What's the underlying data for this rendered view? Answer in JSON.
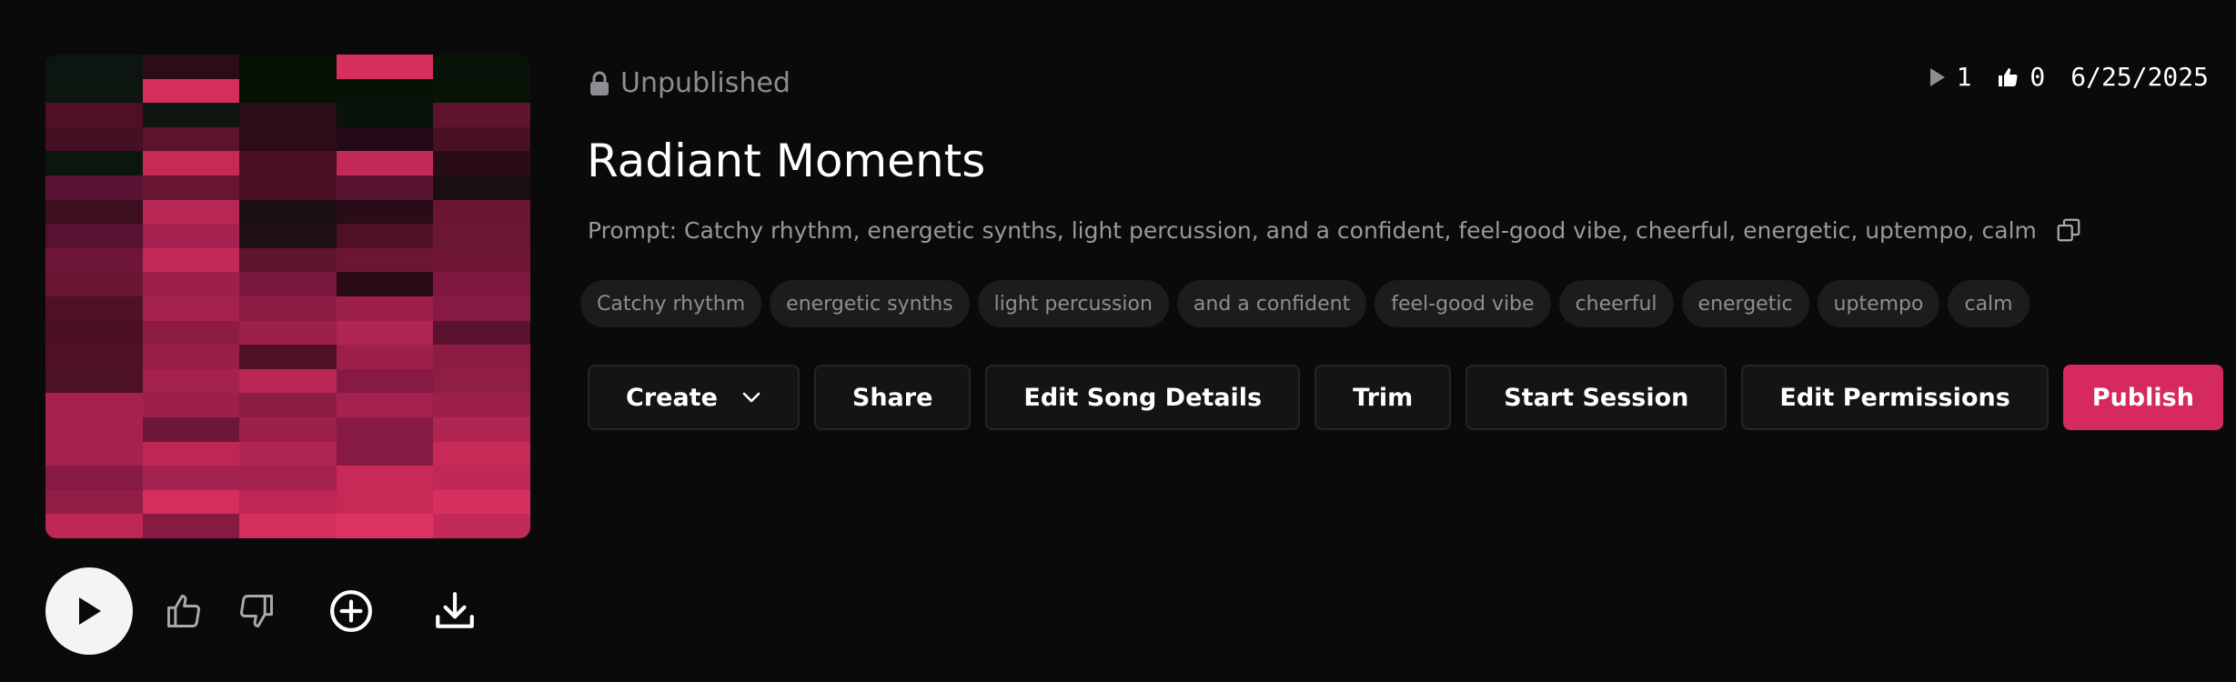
{
  "song": {
    "status": "Unpublished",
    "title": "Radiant Moments",
    "prompt": "Prompt: Catchy rhythm, energetic synths, light percussion, and a confident, feel-good vibe, cheerful, energetic, uptempo, calm"
  },
  "stats": {
    "plays": "1",
    "likes": "0",
    "date": "6/25/2025"
  },
  "tags": [
    "Catchy rhythm",
    "energetic synths",
    "light percussion",
    "and a confident",
    "feel-good vibe",
    "cheerful",
    "energetic",
    "uptempo",
    "calm"
  ],
  "actions": {
    "create": "Create",
    "share": "Share",
    "edit_details": "Edit Song Details",
    "trim": "Trim",
    "start_session": "Start Session",
    "edit_permissions": "Edit Permissions",
    "publish": "Publish"
  },
  "icons": {
    "status": "lock-icon",
    "plays": "play-icon",
    "likes": "thumbs-up-icon",
    "copy": "copy-icon",
    "create_menu": "chevron-down-icon",
    "player": [
      "play-icon",
      "thumbs-up-icon",
      "thumbs-down-icon",
      "plus-circle-icon",
      "download-icon"
    ]
  },
  "colors": {
    "background": "#0a0a0b",
    "accent": "#d5295f",
    "muted_text": "#8d8d92",
    "button_bg": "#141416",
    "tag_bg": "#1c1c1e"
  },
  "cover_art": {
    "columns": 5,
    "rows": 20,
    "cells": [
      "#0c150f",
      "#2c0c19",
      "#061206",
      "#d8305e",
      "#081409",
      "#0d150f",
      "#d42e5c",
      "#061206",
      "#071207",
      "#071307",
      "#4f1026",
      "#0f1610",
      "#2b0c19",
      "#081409",
      "#5e132e",
      "#441023",
      "#5d132c",
      "#2b0c19",
      "#240a16",
      "#4b1025",
      "#0d150f",
      "#c82a58",
      "#4b1025",
      "#c22b58",
      "#2a0c18",
      "#591231",
      "#681532",
      "#4b1025",
      "#5a132e",
      "#1a0e14",
      "#3d0e20",
      "#b82754",
      "#1a0e14",
      "#2a0c18",
      "#6a1534",
      "#561230",
      "#a52250",
      "#221018",
      "#4f1026",
      "#6c1636",
      "#6e1638",
      "#c22b58",
      "#5e132e",
      "#6c1636",
      "#701637",
      "#6a1534",
      "#9c2049",
      "#7a1840",
      "#2a0c18",
      "#80193f",
      "#501128",
      "#a52250",
      "#8c1c44",
      "#9c2049",
      "#861a42",
      "#4b1025",
      "#8c1c44",
      "#9c2049",
      "#b02552",
      "#5a132e",
      "#501128",
      "#961e47",
      "#4f1026",
      "#9c2049",
      "#8c1c44",
      "#4d1126",
      "#a52250",
      "#b82754",
      "#861a42",
      "#901d45",
      "#a52250",
      "#9c2049",
      "#8c1c44",
      "#a52250",
      "#9c2049",
      "#a52250",
      "#6e1638",
      "#9c2049",
      "#861a42",
      "#b02552",
      "#a52250",
      "#bd2655",
      "#b02552",
      "#861a42",
      "#c82a58",
      "#861a42",
      "#a52250",
      "#a52250",
      "#c82a58",
      "#c02857",
      "#901d45",
      "#d42e5c",
      "#bd2655",
      "#c82a58",
      "#d8305e",
      "#bd2655",
      "#861a42",
      "#d42e5c",
      "#de3262",
      "#c22b58"
    ]
  }
}
